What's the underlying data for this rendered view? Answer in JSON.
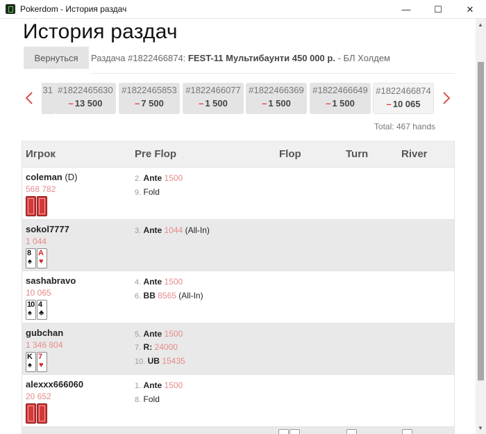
{
  "window": {
    "title": "Pokerdom - История раздач",
    "min": "—",
    "max": "☐",
    "close": "✕"
  },
  "page": {
    "title": "История раздач",
    "back_label": "Вернуться"
  },
  "hand": {
    "prefix": "Раздача #1822466874:",
    "tournament": "FEST-11 Мультибаунти 450 000 р.",
    "game": "- БЛ Холдем"
  },
  "hands_strip": [
    {
      "id": "#1822465630",
      "amount": "13 500"
    },
    {
      "id": "#1822465853",
      "amount": "7 500"
    },
    {
      "id": "#1822466077",
      "amount": "1 500"
    },
    {
      "id": "#1822466369",
      "amount": "1 500"
    },
    {
      "id": "#1822466649",
      "amount": "1 500"
    },
    {
      "id": "#1822466874",
      "amount": "10 065",
      "active": true
    }
  ],
  "hands_strip_partial": "31",
  "total": "Total: 467 hands",
  "table": {
    "headers": [
      "Игрок",
      "Pre Flop",
      "Flop",
      "Turn",
      "River"
    ],
    "players": [
      {
        "name": "coleman",
        "tag": "(D)",
        "stack": "568 782",
        "cards": "back",
        "actions": [
          {
            "num": "2.",
            "name": "Ante",
            "val": "1500",
            "suffix": ""
          },
          {
            "num": "9.",
            "name": "Fold",
            "val": "",
            "suffix": ""
          }
        ]
      },
      {
        "name": "sokol7777",
        "tag": "",
        "stack": "1 044",
        "cards": [
          {
            "rank": "8",
            "suit": "♠",
            "color": "black"
          },
          {
            "rank": "A",
            "suit": "♥",
            "color": "red"
          }
        ],
        "actions": [
          {
            "num": "3.",
            "name": "Ante",
            "val": "1044",
            "suffix": "(All-In)"
          }
        ]
      },
      {
        "name": "sashabravo",
        "tag": "",
        "stack": "10 065",
        "cards": [
          {
            "rank": "10",
            "suit": "♠",
            "color": "black"
          },
          {
            "rank": "4",
            "suit": "♣",
            "color": "black"
          }
        ],
        "actions": [
          {
            "num": "4.",
            "name": "Ante",
            "val": "1500",
            "suffix": ""
          },
          {
            "num": "6.",
            "name": "BB",
            "val": "8565",
            "suffix": "(All-In)"
          }
        ]
      },
      {
        "name": "gubchan",
        "tag": "",
        "stack": "1 346 804",
        "cards": [
          {
            "rank": "K",
            "suit": "♠",
            "color": "black"
          },
          {
            "rank": "7",
            "suit": "♥",
            "color": "red"
          }
        ],
        "actions": [
          {
            "num": "5.",
            "name": "Ante",
            "val": "1500",
            "suffix": ""
          },
          {
            "num": "7.",
            "name": "R:",
            "val": "24000",
            "suffix": ""
          },
          {
            "num": "10.",
            "name": "UB",
            "val": "15435",
            "suffix": ""
          }
        ]
      },
      {
        "name": "alexxx666060",
        "tag": "",
        "stack": "20 652",
        "cards": "back",
        "actions": [
          {
            "num": "1.",
            "name": "Ante",
            "val": "1500",
            "suffix": ""
          },
          {
            "num": "8.",
            "name": "Fold",
            "val": "",
            "suffix": ""
          }
        ]
      }
    ]
  },
  "colors": {
    "minus": "#e23c3c",
    "stack": "#e68a8a",
    "arrow": "#d9534f"
  }
}
